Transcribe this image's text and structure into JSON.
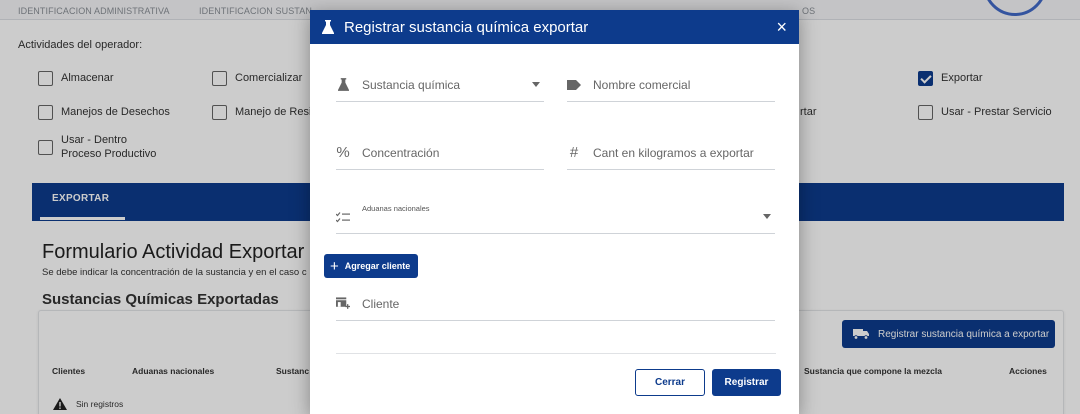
{
  "top_tabs": [
    "IDENTIFICACION ADMINISTRATIVA",
    "IDENTIFICACION SUSTAN",
    "OS"
  ],
  "activities": {
    "title": "Actividades del operador:",
    "items": [
      {
        "label": "Almacenar",
        "checked": false
      },
      {
        "label": "Comercializar",
        "checked": false
      },
      {
        "label": "Exportar",
        "checked": true
      },
      {
        "label": "Manejos de Desechos",
        "checked": false
      },
      {
        "label": "Manejo de Residu",
        "checked": false
      },
      {
        "label": "rtar",
        "checked": false
      },
      {
        "label": "Usar - Prestar Servicio",
        "checked": false
      },
      {
        "label": "Usar - Dentro Proceso Productivo",
        "checked": false
      }
    ]
  },
  "section_tab": "EXPORTAR",
  "form": {
    "title": "Formulario Actividad Exportar",
    "subtitle": "Se debe indicar la concentración de la sustancia y en el caso c",
    "section_title": "Sustancias Químicas Exportadas",
    "register_button": "Registrar sustancia química a exportar",
    "table_headers": [
      "Clientes",
      "Aduanas nacionales",
      "Sustanc",
      "Sustancia que compone la mezcla",
      "Acciones"
    ],
    "empty_text": "Sin registros"
  },
  "modal": {
    "title": "Registrar sustancia química exportar",
    "close_icon": "×",
    "fields": {
      "sustancia": "Sustancia química",
      "nombre_comercial": "Nombre comercial",
      "concentracion": "Concentración",
      "cantidad": "Cant en kilogramos a exportar",
      "aduanas": "Aduanas nacionales",
      "cliente": "Cliente"
    },
    "add_client_button": "Agregar cliente",
    "cerrar_button": "Cerrar",
    "registrar_button": "Registrar"
  },
  "colors": {
    "primary": "#0d3b8c",
    "overlay": "rgba(0,0,0,0.2)",
    "accent_circle": "#4169c7"
  },
  "icons": {
    "flask": "flask-icon",
    "tag": "tag-icon",
    "percent": "percent-icon",
    "hash": "hash-icon",
    "checklist": "checklist-icon",
    "client": "client-add-icon",
    "warning": "warning-icon",
    "truck": "truck-icon"
  }
}
